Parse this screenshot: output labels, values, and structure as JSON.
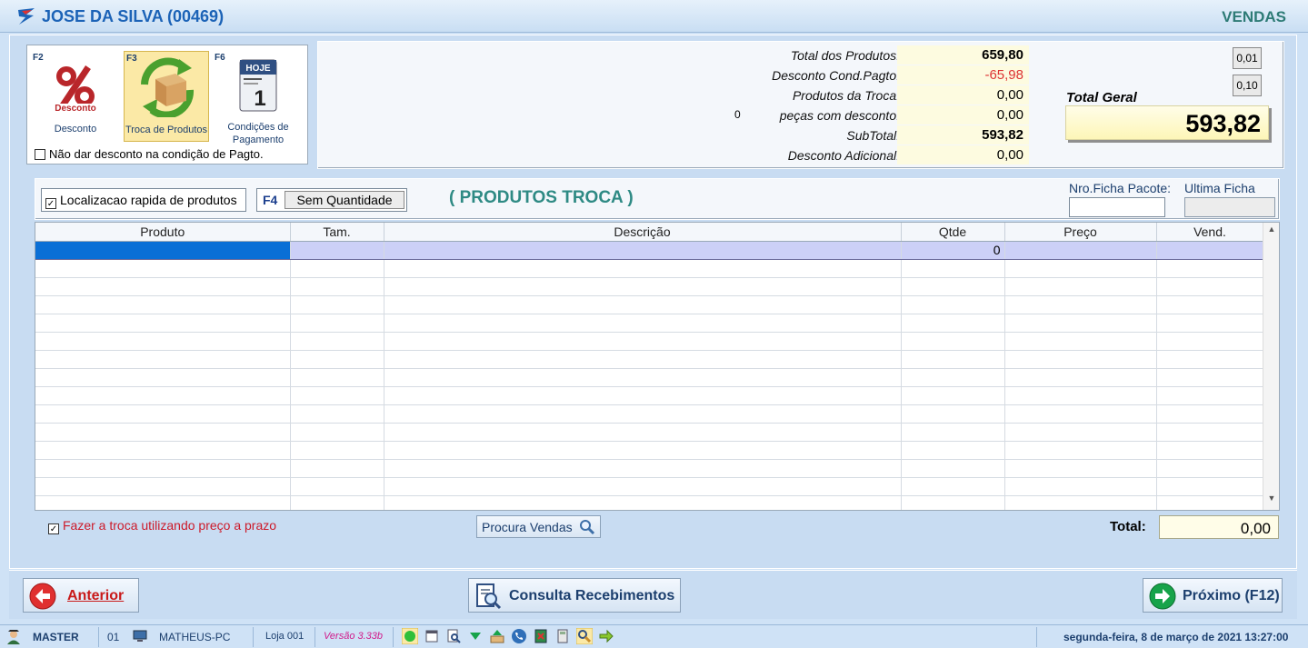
{
  "window": {
    "title": "JOSE DA SILVA (00469)",
    "module": "VENDAS"
  },
  "tools": [
    {
      "key": "F2",
      "label": "Desconto",
      "icon": "percent-discount-icon"
    },
    {
      "key": "F3",
      "label": "Troca de Produtos",
      "icon": "product-exchange-box-icon"
    },
    {
      "key": "F6",
      "label_line1": "Condições de",
      "label_line2": "Pagamento",
      "icon": "calendar-hoje-icon",
      "calendar_header": "HOJE",
      "calendar_day": "1"
    }
  ],
  "no_discount_label": "Não dar desconto na condição de Pagto.",
  "totals": {
    "total_produtos_label": "Total dos Produtos:",
    "total_produtos": "659,80",
    "desconto_cond_label": "Desconto Cond.Pagto:",
    "desconto_cond": "-65,98",
    "produtos_troca_label": "Produtos da Troca:",
    "produtos_troca": "0,00",
    "pecas_count": "0",
    "pecas_label": "peças com desconto:",
    "pecas_valor": "0,00",
    "subtotal_label": "SubTotal:",
    "subtotal": "593,82",
    "desconto_adicional_label": "Desconto Adicional:",
    "desconto_adicional": "0,00",
    "round_001": "0,01",
    "round_010": "0,10",
    "total_geral_label": "Total Geral",
    "total_geral": "593,82"
  },
  "filter": {
    "quick_search_label": "Localizacao rapida de produtos",
    "f4_key": "F4",
    "f4_button": "Sem Quantidade",
    "panel_title": "( PRODUTOS TROCA )",
    "nro_ficha_label": "Nro.Ficha Pacote:",
    "ultima_ficha_label": "Ultima Ficha"
  },
  "grid": {
    "columns": [
      "Produto",
      "Tam.",
      "Descrição",
      "Qtde",
      "Preço",
      "Vend."
    ],
    "first_row_qtde": "0"
  },
  "troca_prazo_label": "Fazer a troca utilizando preço a prazo",
  "procura_vendas_label": "Procura Vendas",
  "total_label": "Total:",
  "total_value": "0,00",
  "nav": {
    "anterior": "Anterior",
    "consulta": "Consulta Recebimentos",
    "proximo": "Próximo (F12)"
  },
  "status": {
    "user": "MASTER",
    "station_no": "01",
    "computer": "MATHEUS-PC",
    "store": "Loja 001",
    "version": "Versão 3.33b",
    "datetime": "segunda-feira, 8 de março de 2021 13:27:00"
  },
  "colors": {
    "title_blue": "#1c63b7",
    "module_teal": "#2e7b76",
    "panel_title": "#2e8a84",
    "red": "#cc1a2a"
  }
}
